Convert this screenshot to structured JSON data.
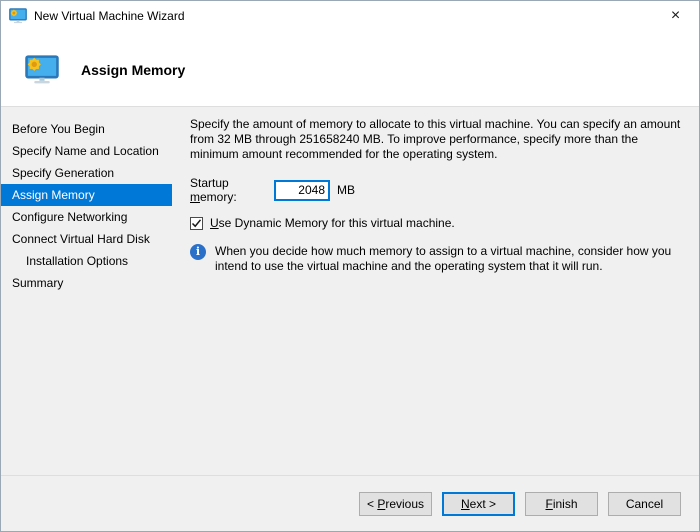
{
  "window": {
    "title": "New Virtual Machine Wizard",
    "close_glyph": "×"
  },
  "header": {
    "title": "Assign Memory"
  },
  "sidebar": {
    "items": [
      {
        "label": "Before You Begin",
        "selected": false,
        "indented": false
      },
      {
        "label": "Specify Name and Location",
        "selected": false,
        "indented": false
      },
      {
        "label": "Specify Generation",
        "selected": false,
        "indented": false
      },
      {
        "label": "Assign Memory",
        "selected": true,
        "indented": false
      },
      {
        "label": "Configure Networking",
        "selected": false,
        "indented": false
      },
      {
        "label": "Connect Virtual Hard Disk",
        "selected": false,
        "indented": false
      },
      {
        "label": "Installation Options",
        "selected": false,
        "indented": true
      },
      {
        "label": "Summary",
        "selected": false,
        "indented": false
      }
    ]
  },
  "content": {
    "description": "Specify the amount of memory to allocate to this virtual machine. You can specify an amount from 32 MB through 251658240 MB. To improve performance, specify more than the minimum amount recommended for the operating system.",
    "startup_memory": {
      "label_pre": "Startup ",
      "label_key": "m",
      "label_post": "emory:",
      "value": "2048",
      "unit": "MB"
    },
    "dynamic_memory": {
      "label_pre": "",
      "label_key": "U",
      "label_post": "se Dynamic Memory for this virtual machine.",
      "checked": true
    },
    "info": {
      "text": "When you decide how much memory to assign to a virtual machine, consider how you intend to use the virtual machine and the operating system that it will run."
    }
  },
  "footer": {
    "buttons": [
      {
        "pre": "< ",
        "key": "P",
        "post": "revious",
        "default": false
      },
      {
        "pre": "",
        "key": "N",
        "post": "ext >",
        "default": true
      },
      {
        "pre": "",
        "key": "F",
        "post": "inish",
        "default": false
      },
      {
        "pre": "Cancel",
        "key": "",
        "post": "",
        "default": false
      }
    ]
  },
  "colors": {
    "accent": "#0078d7",
    "body_bg": "#f0f0f0",
    "info_icon_blue": "#2b70c8",
    "monitor_screen": "#45aeec",
    "gear_yellow": "#f6c21c"
  }
}
